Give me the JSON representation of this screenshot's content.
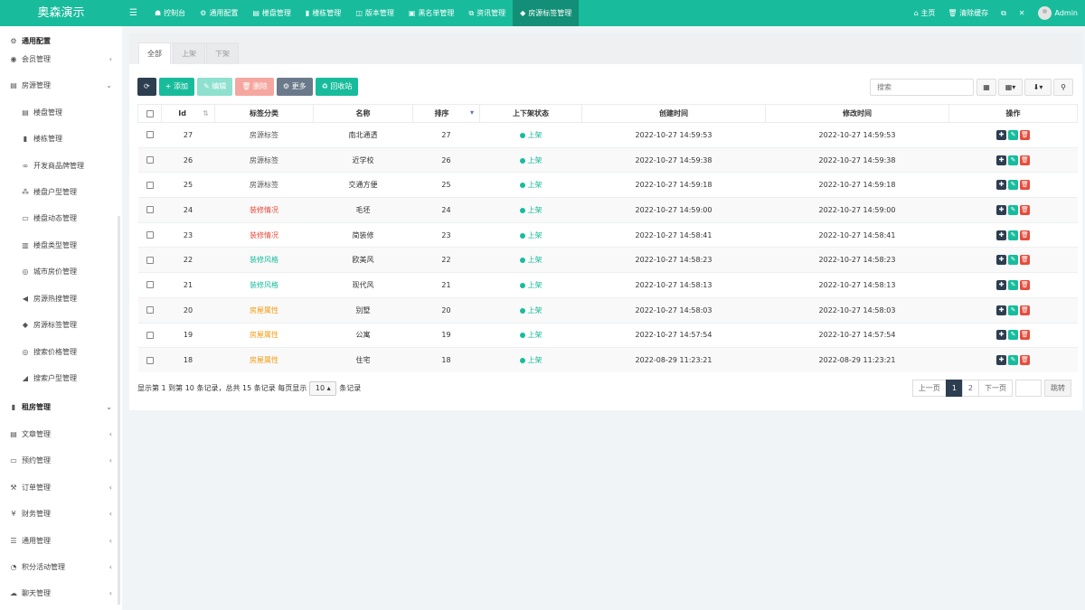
{
  "app": {
    "logo": "奥森演示"
  },
  "topnav": [
    {
      "icon": "☗",
      "label": "控制台",
      "active": false
    },
    {
      "icon": "⚙",
      "label": "通用配置",
      "active": false
    },
    {
      "icon": "▤",
      "label": "楼盘管理",
      "active": false
    },
    {
      "icon": "▮",
      "label": "楼栋管理",
      "active": false
    },
    {
      "icon": "◫",
      "label": "版本管理",
      "active": false
    },
    {
      "icon": "▣",
      "label": "黑名单管理",
      "active": false
    },
    {
      "icon": "⧉",
      "label": "资讯管理",
      "active": false
    },
    {
      "icon": "◆",
      "label": "房源标签管理",
      "active": true
    }
  ],
  "topright": {
    "home": "主页",
    "clear_cache": "清除缓存",
    "user": "Admin"
  },
  "sidebar": [
    {
      "icon": "⚙",
      "label": "通用配置",
      "bold": true,
      "arrow": ""
    },
    {
      "icon": "◉",
      "label": "会员管理",
      "bold": false,
      "arrow": "‹"
    },
    {
      "icon": "▤",
      "label": "房源管理",
      "bold": false,
      "arrow": "⌄"
    },
    {
      "icon": "▤",
      "label": "楼盘管理",
      "bold": false,
      "arrow": "",
      "sub": true
    },
    {
      "icon": "▮",
      "label": "楼栋管理",
      "bold": false,
      "arrow": "",
      "sub": true
    },
    {
      "icon": "∞",
      "label": "开发商品牌管理",
      "bold": false,
      "arrow": "",
      "sub": true
    },
    {
      "icon": "⁂",
      "label": "楼盘户型管理",
      "bold": false,
      "arrow": "",
      "sub": true
    },
    {
      "icon": "▭",
      "label": "楼盘动态管理",
      "bold": false,
      "arrow": "",
      "sub": true
    },
    {
      "icon": "▥",
      "label": "楼盘类型管理",
      "bold": false,
      "arrow": "",
      "sub": true
    },
    {
      "icon": "◎",
      "label": "城市房价管理",
      "bold": false,
      "arrow": "",
      "sub": true
    },
    {
      "icon": "◀",
      "label": "房源热搜管理",
      "bold": false,
      "arrow": "",
      "sub": true
    },
    {
      "icon": "◆",
      "label": "房源标签管理",
      "bold": false,
      "arrow": "",
      "sub": true
    },
    {
      "icon": "◎",
      "label": "搜索价格管理",
      "bold": false,
      "arrow": "",
      "sub": true
    },
    {
      "icon": "◢",
      "label": "搜索户型管理",
      "bold": false,
      "arrow": "",
      "sub": true
    },
    {
      "icon": "▮",
      "label": "租房管理",
      "bold": true,
      "arrow": "⌄"
    },
    {
      "icon": "▤",
      "label": "文章管理",
      "bold": false,
      "arrow": "‹"
    },
    {
      "icon": "▭",
      "label": "预约管理",
      "bold": false,
      "arrow": "‹"
    },
    {
      "icon": "⚒",
      "label": "订单管理",
      "bold": false,
      "arrow": "‹"
    },
    {
      "icon": "¥",
      "label": "财务管理",
      "bold": false,
      "arrow": "‹"
    },
    {
      "icon": "☰",
      "label": "通用管理",
      "bold": false,
      "arrow": "‹"
    },
    {
      "icon": "◔",
      "label": "积分活动管理",
      "bold": false,
      "arrow": "‹"
    },
    {
      "icon": "☁",
      "label": "聊天管理",
      "bold": false,
      "arrow": "‹"
    }
  ],
  "tabs": [
    {
      "label": "全部",
      "active": true
    },
    {
      "label": "上架",
      "active": false
    },
    {
      "label": "下架",
      "active": false
    }
  ],
  "toolbar": {
    "refresh_icon": "⟳",
    "add": "+ 添加",
    "edit": "✎ 编辑",
    "delete": "🗑 删除",
    "more": "⚙ 更多",
    "recycle": "♻ 回收站",
    "search_placeholder": "搜索"
  },
  "table": {
    "columns": [
      "Id",
      "标签分类",
      "名称",
      "排序",
      "上下架状态",
      "创建时间",
      "修改时间",
      "操作"
    ],
    "rows": [
      {
        "id": "27",
        "category": "房源标签",
        "cat_color": "#555555",
        "name": "南北通透",
        "sort": "27",
        "status": "上架",
        "created": "2022-10-27 14:59:53",
        "updated": "2022-10-27 14:59:53"
      },
      {
        "id": "26",
        "category": "房源标签",
        "cat_color": "#555555",
        "name": "近学校",
        "sort": "26",
        "status": "上架",
        "created": "2022-10-27 14:59:38",
        "updated": "2022-10-27 14:59:38"
      },
      {
        "id": "25",
        "category": "房源标签",
        "cat_color": "#555555",
        "name": "交通方便",
        "sort": "25",
        "status": "上架",
        "created": "2022-10-27 14:59:18",
        "updated": "2022-10-27 14:59:18"
      },
      {
        "id": "24",
        "category": "装修情况",
        "cat_color": "#e74c3c",
        "name": "毛坯",
        "sort": "24",
        "status": "上架",
        "created": "2022-10-27 14:59:00",
        "updated": "2022-10-27 14:59:00"
      },
      {
        "id": "23",
        "category": "装修情况",
        "cat_color": "#e74c3c",
        "name": "简装修",
        "sort": "23",
        "status": "上架",
        "created": "2022-10-27 14:58:41",
        "updated": "2022-10-27 14:58:41"
      },
      {
        "id": "22",
        "category": "装修风格",
        "cat_color": "#18bc9c",
        "name": "欧美风",
        "sort": "22",
        "status": "上架",
        "created": "2022-10-27 14:58:23",
        "updated": "2022-10-27 14:58:23"
      },
      {
        "id": "21",
        "category": "装修风格",
        "cat_color": "#18bc9c",
        "name": "现代风",
        "sort": "21",
        "status": "上架",
        "created": "2022-10-27 14:58:13",
        "updated": "2022-10-27 14:58:13"
      },
      {
        "id": "20",
        "category": "房屋属性",
        "cat_color": "#f39c12",
        "name": "别墅",
        "sort": "20",
        "status": "上架",
        "created": "2022-10-27 14:58:03",
        "updated": "2022-10-27 14:58:03"
      },
      {
        "id": "19",
        "category": "房屋属性",
        "cat_color": "#f39c12",
        "name": "公寓",
        "sort": "19",
        "status": "上架",
        "created": "2022-10-27 14:57:54",
        "updated": "2022-10-27 14:57:54"
      },
      {
        "id": "18",
        "category": "房屋属性",
        "cat_color": "#f39c12",
        "name": "住宅",
        "sort": "18",
        "status": "上架",
        "created": "2022-08-29 11:23:21",
        "updated": "2022-08-29 11:23:21"
      }
    ]
  },
  "footer": {
    "info_prefix": "显示第 1 到第 10 条记录，总共 15 条记录 每页显示",
    "page_size": "10",
    "info_suffix": "条记录"
  },
  "pager": {
    "prev": "上一页",
    "pages": [
      "1",
      "2"
    ],
    "active": "1",
    "next": "下一页",
    "go": "跳转"
  },
  "colors": {
    "brand": "#18bc9c",
    "dark": "#2c3e50",
    "danger": "#e74c3c",
    "warning": "#f39c12"
  }
}
